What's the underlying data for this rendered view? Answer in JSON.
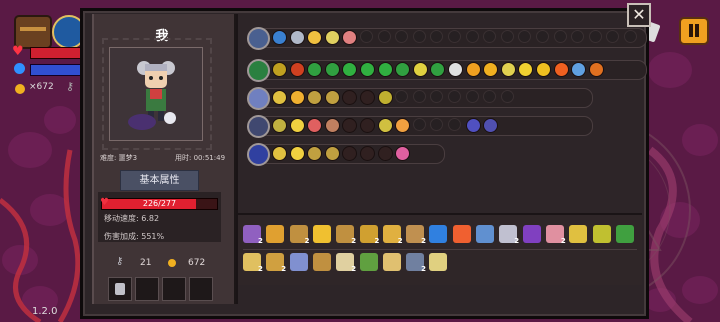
{
  "hud": {
    "gold": "×672",
    "version": "1.2.0",
    "icons": [
      "backpack-icon",
      "weapon-orb-icon",
      "heart-icon",
      "mana-icon",
      "coin-icon",
      "key-icon",
      "pause-icon",
      "scroll-icon"
    ]
  },
  "panel": {
    "close_label": "✕",
    "character": {
      "name": "我",
      "difficulty": "难度: 噩梦3",
      "time": "用时: 00:51:49",
      "attr_button": "基本属性",
      "hp_text": "226/277",
      "hp_current": 226,
      "hp_max": 277,
      "move_speed": "移动速度: 6.82",
      "damage_bonus": "伤害加成: 551%",
      "keys": "21",
      "gold": "672"
    },
    "weapon_rows": [
      {
        "weapon": "bag-relic-icon",
        "color": "#4a6090",
        "slots": [
          "#3a80d0",
          "#b0b8c8",
          "#f0c040",
          "#e0d060",
          "#e08080"
        ],
        "empty": 16
      },
      {
        "weapon": "green-staff-icon",
        "color": "#2a8040",
        "slots": [
          "#c0a020",
          "#d04020",
          "#30a040",
          "#30a040",
          "#30b040",
          "#30b040",
          "#30b040",
          "#30a040",
          "#e0d040",
          "#30a040",
          "#e0e0e0",
          "#f0a020",
          "#f0b020",
          "#e0d050",
          "#f0d030",
          "#f0c020",
          "#f06020",
          "#60a0e0",
          "#e07020"
        ],
        "empty": 0
      },
      {
        "weapon": "light-staff-icon",
        "color": "#7080c0",
        "slots": [
          "#e0c040",
          "#f0b030",
          "#c0a040",
          "#c0a040",
          "#302020",
          "#302020",
          "#c0b030"
        ],
        "empty": 7
      },
      {
        "weapon": "dark-wand-icon",
        "color": "#404870",
        "slots": [
          "#c0b040",
          "#f0d040",
          "#e06060",
          "#c08060",
          "#302020",
          "#302020",
          "#d0c040",
          "#f0a040"
        ],
        "empty": 3,
        "tail": [
          "#5050c0",
          "#5050b0"
        ]
      },
      {
        "weapon": "blue-orb-icon",
        "color": "#3040a0",
        "slots": [
          "#e0c040",
          "#f0d040",
          "#c0a040",
          "#c0a040",
          "#302020",
          "#302020",
          "#302020",
          "#e060a0"
        ],
        "empty": 0
      }
    ],
    "inventory": {
      "row1": [
        {
          "icon": "purple-shield-icon",
          "color": "#9060c0",
          "count": "2"
        },
        {
          "icon": "bell-icon",
          "color": "#e0a030",
          "count": ""
        },
        {
          "icon": "sack-icon",
          "color": "#c09040",
          "count": "2"
        },
        {
          "icon": "trophy-icon",
          "color": "#f0c030",
          "count": ""
        },
        {
          "icon": "scroll-icon",
          "color": "#c09040",
          "count": "2"
        },
        {
          "icon": "hammer-icon",
          "color": "#d0a030",
          "count": "2"
        },
        {
          "icon": "horn-icon",
          "color": "#e0b040",
          "count": "2"
        },
        {
          "icon": "cookie-icon",
          "color": "#c09050",
          "count": "2"
        },
        {
          "icon": "mirror-icon",
          "color": "#3080e0",
          "count": ""
        },
        {
          "icon": "heart-item-icon",
          "color": "#f06030",
          "count": ""
        },
        {
          "icon": "drop-icon",
          "color": "#6090d0",
          "count": ""
        },
        {
          "icon": "moon-icon",
          "color": "#c0c0d0",
          "count": "2"
        },
        {
          "icon": "witch-hat-icon",
          "color": "#8040c0",
          "count": ""
        },
        {
          "icon": "pig-icon",
          "color": "#e090a0",
          "count": "2"
        },
        {
          "icon": "horn-shell-icon",
          "color": "#e0c040",
          "count": ""
        },
        {
          "icon": "key-item-icon",
          "color": "#c0c030",
          "count": ""
        },
        {
          "icon": "green-claw-icon",
          "color": "#40a040",
          "count": ""
        }
      ],
      "row2": [
        {
          "icon": "bones-icon",
          "color": "#e0c060",
          "count": "2"
        },
        {
          "icon": "lamp-icon",
          "color": "#d0a040",
          "count": "2"
        },
        {
          "icon": "cage-icon",
          "color": "#8090d0",
          "count": ""
        },
        {
          "icon": "jar-icon",
          "color": "#c09040",
          "count": ""
        },
        {
          "icon": "rice-icon",
          "color": "#e0d0a0",
          "count": "2"
        },
        {
          "icon": "leaf-icon",
          "color": "#60a040",
          "count": ""
        },
        {
          "icon": "bandage-icon",
          "color": "#e0c070",
          "count": ""
        },
        {
          "icon": "cannon-icon",
          "color": "#7080a0",
          "count": "2"
        },
        {
          "icon": "gift-icon",
          "color": "#e0d080",
          "count": ""
        }
      ]
    }
  }
}
